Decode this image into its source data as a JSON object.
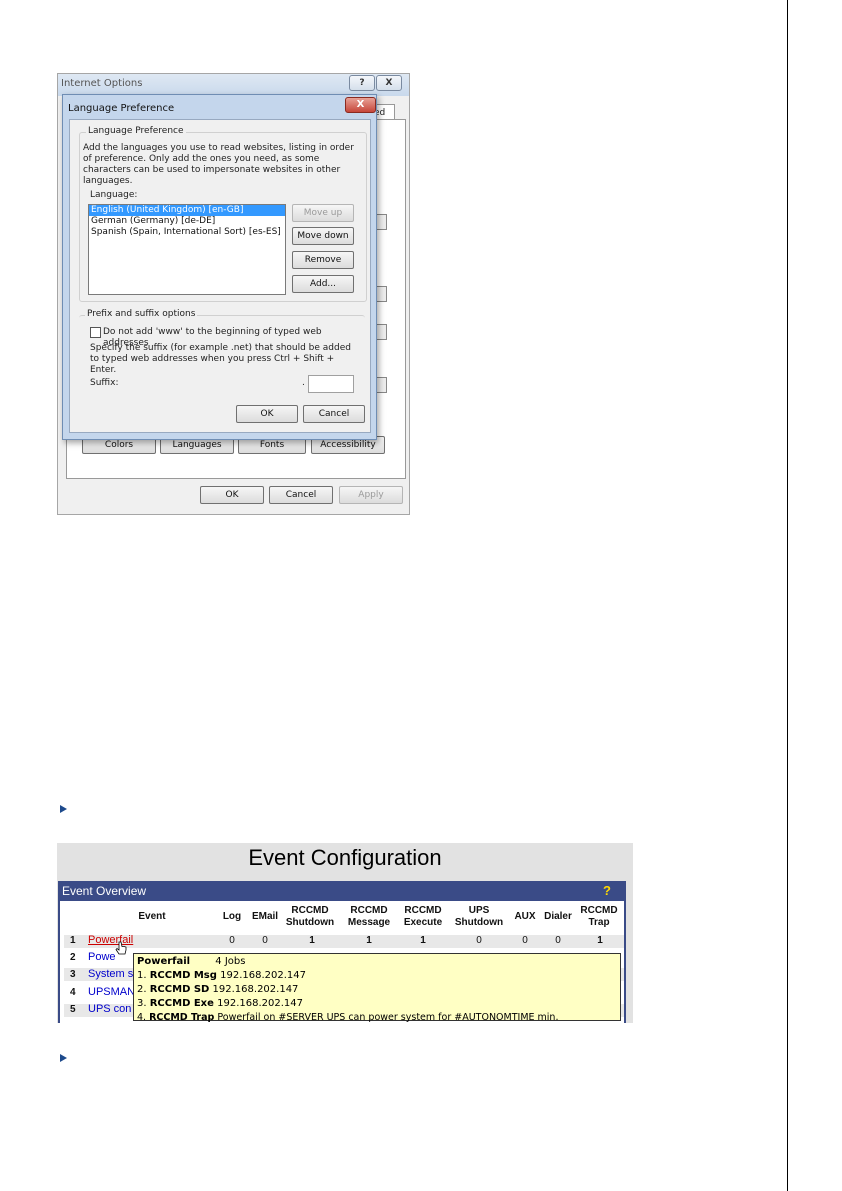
{
  "internet_options": {
    "title": "Internet Options",
    "help_glyph": "?",
    "close_glyph": "X",
    "tab_fragment": "ed",
    "buttons": {
      "colors": "Colors",
      "languages": "Languages",
      "fonts": "Fonts",
      "accessibility": "Accessibility",
      "ok": "OK",
      "cancel": "Cancel",
      "apply": "Apply"
    }
  },
  "language_preference": {
    "title": "Language Preference",
    "close_glyph": "X",
    "group_title": "Language Preference",
    "description": "Add the languages you use to read websites, listing in order of preference. Only add the ones you need, as some characters can be used to impersonate websites in other languages.",
    "language_label": "Language:",
    "languages": [
      "English (United Kingdom) [en-GB]",
      "German (Germany) [de-DE]",
      "Spanish (Spain, International Sort) [es-ES]"
    ],
    "buttons": {
      "move_up": "Move up",
      "move_down": "Move down",
      "remove": "Remove",
      "add": "Add..."
    },
    "prefix_group_title": "Prefix and suffix options",
    "www_checkbox_label": "Do not add 'www' to the beginning of typed web addresses",
    "suffix_description": "Specify the suffix (for example .net) that should be added to typed web addresses when you press Ctrl + Shift + Enter.",
    "suffix_label": "Suffix:",
    "suffix_dot": ".",
    "suffix_value": "",
    "ok": "OK",
    "cancel": "Cancel"
  },
  "event_configuration": {
    "title": "Event Configuration",
    "overview_title": "Event Overview",
    "help_glyph": "?",
    "columns": {
      "event": "Event",
      "log": "Log",
      "email": "EMail",
      "rccmd_shutdown": [
        "RCCMD",
        "Shutdown"
      ],
      "rccmd_message": [
        "RCCMD",
        "Message"
      ],
      "rccmd_execute": [
        "RCCMD",
        "Execute"
      ],
      "ups_shutdown": [
        "UPS",
        "Shutdown"
      ],
      "aux": "AUX",
      "dialer": "Dialer",
      "rccmd_trap": [
        "RCCMD",
        "Trap"
      ]
    },
    "rows": [
      {
        "num": "1",
        "name": "Powerfail",
        "log": "0",
        "email": "0",
        "rccmd_shutdown": "1",
        "rccmd_message": "1",
        "rccmd_execute": "1",
        "ups_shutdown": "0",
        "aux": "0",
        "dialer": "0",
        "rccmd_trap": "1"
      },
      {
        "num": "2",
        "name": "Powe"
      },
      {
        "num": "3",
        "name": "System s"
      },
      {
        "num": "4",
        "name": "UPSMAN"
      },
      {
        "num": "5",
        "name": "UPS con"
      }
    ],
    "tooltip": {
      "title": "Powerfail",
      "jobs": "4 Jobs",
      "lines": [
        {
          "prefix": "1. ",
          "label": "RCCMD Msg",
          "value": " 192.168.202.147"
        },
        {
          "prefix": "2. ",
          "label": "RCCMD SD",
          "value": " 192.168.202.147"
        },
        {
          "prefix": "3. ",
          "label": "RCCMD Exe",
          "value": " 192.168.202.147"
        },
        {
          "prefix": "4. ",
          "label": "RCCMD Trap",
          "value": " Powerfail on #SERVER UPS can power system for #AUTONOMTIME min."
        }
      ]
    }
  }
}
